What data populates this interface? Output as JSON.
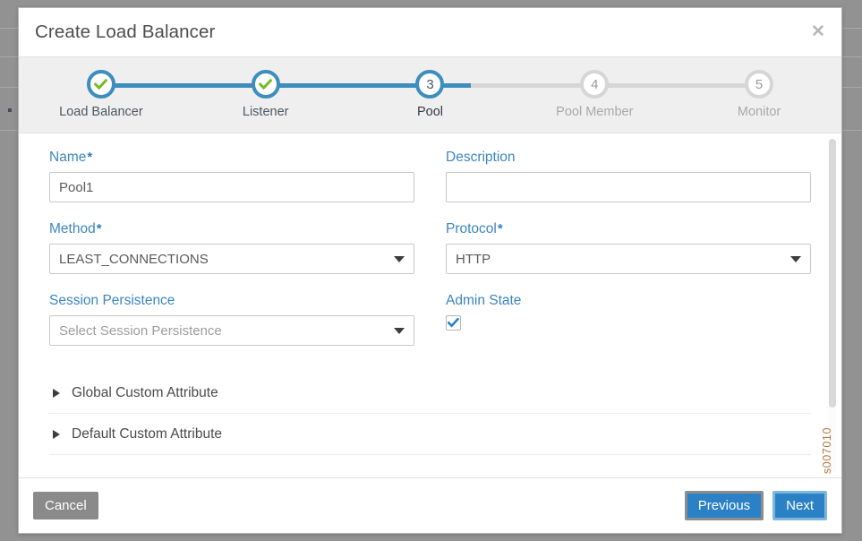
{
  "dialog": {
    "title": "Create Load Balancer",
    "close_icon": "close-icon",
    "watermark": "s007010"
  },
  "stepper": {
    "steps": [
      {
        "number": "1",
        "label": "Load Balancer",
        "state": "done"
      },
      {
        "number": "2",
        "label": "Listener",
        "state": "done"
      },
      {
        "number": "3",
        "label": "Pool",
        "state": "active"
      },
      {
        "number": "4",
        "label": "Pool Member",
        "state": "todo"
      },
      {
        "number": "5",
        "label": "Monitor",
        "state": "todo"
      }
    ],
    "done_color": "#3d8dbe",
    "todo_color": "#d6d6d6",
    "check_color": "#7ab929"
  },
  "form": {
    "name": {
      "label": "Name",
      "required": "*",
      "value": "Pool1",
      "placeholder": ""
    },
    "description": {
      "label": "Description",
      "required": "",
      "value": "",
      "placeholder": ""
    },
    "method": {
      "label": "Method",
      "required": "*",
      "value": "LEAST_CONNECTIONS",
      "is_placeholder": false
    },
    "protocol": {
      "label": "Protocol",
      "required": "*",
      "value": "HTTP",
      "is_placeholder": false
    },
    "session_persistence": {
      "label": "Session Persistence",
      "required": "",
      "value": "Select Session Persistence",
      "is_placeholder": true
    },
    "admin_state": {
      "label": "Admin State",
      "checked": true,
      "check_color": "#2a81c6"
    }
  },
  "accordions": [
    {
      "label": "Global Custom Attribute"
    },
    {
      "label": "Default Custom Attribute"
    }
  ],
  "footer": {
    "cancel_label": "Cancel",
    "previous_label": "Previous",
    "next_label": "Next",
    "primary_color": "#2a81c6"
  }
}
